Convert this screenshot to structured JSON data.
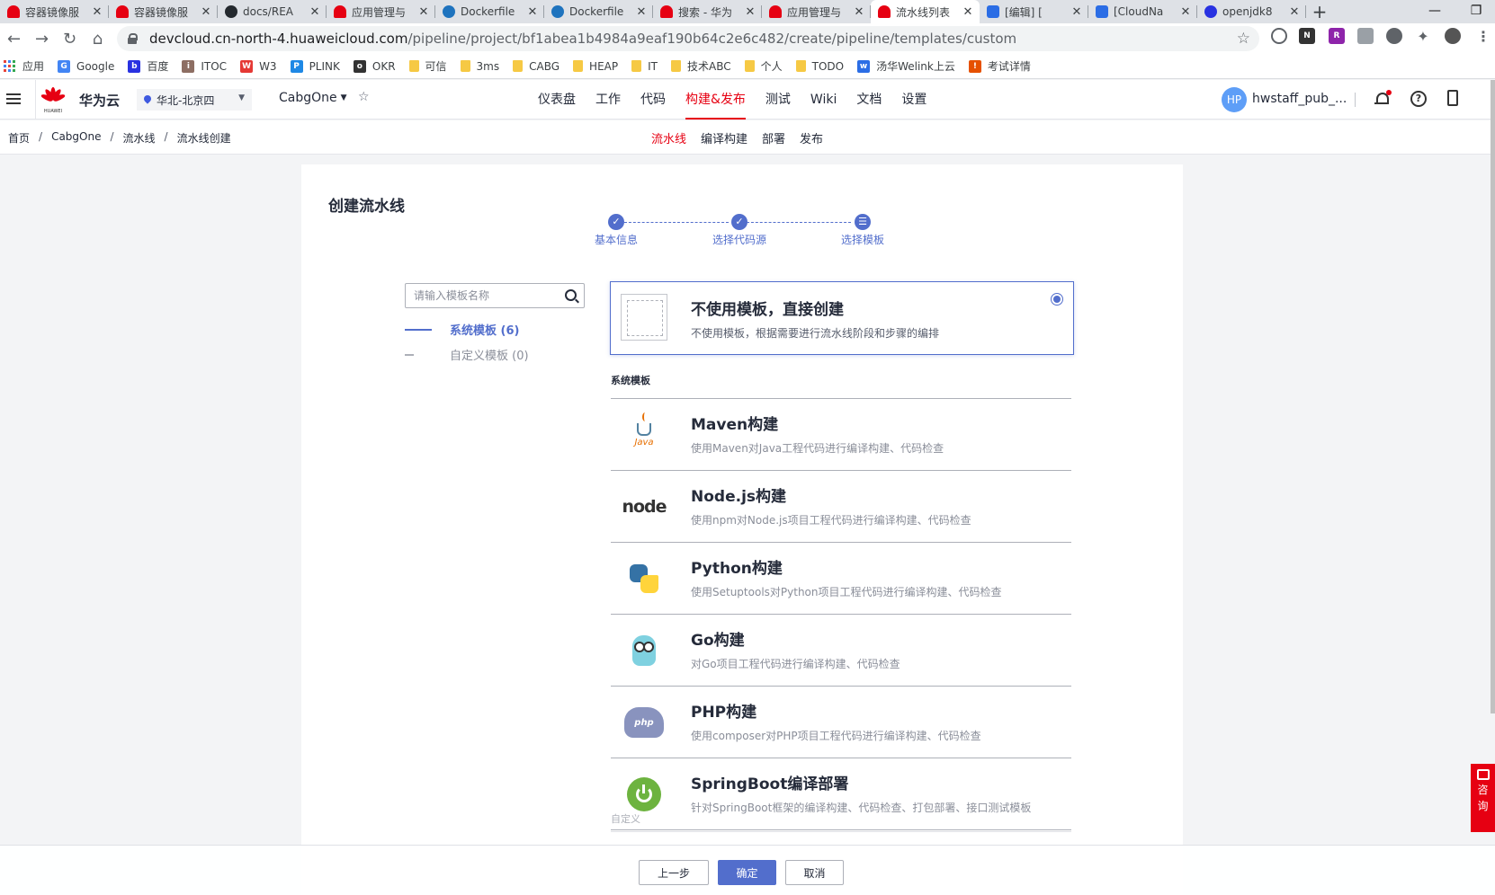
{
  "browser": {
    "tabs": [
      {
        "title": "容器镜像服",
        "favicon": "huawei-icon",
        "active": false
      },
      {
        "title": "容器镜像服",
        "favicon": "huawei-icon",
        "active": false
      },
      {
        "title": "docs/REA",
        "favicon": "github-icon",
        "active": false
      },
      {
        "title": "应用管理与",
        "favicon": "huawei-icon",
        "active": false
      },
      {
        "title": "Dockerfile",
        "favicon": "docker-icon",
        "active": false
      },
      {
        "title": "Dockerfile",
        "favicon": "docker-icon",
        "active": false
      },
      {
        "title": "搜索 - 华为",
        "favicon": "huawei-icon",
        "active": false
      },
      {
        "title": "应用管理与",
        "favicon": "huawei-icon",
        "active": false
      },
      {
        "title": "流水线列表",
        "favicon": "huawei-icon",
        "active": true
      },
      {
        "title": "[编辑] [",
        "favicon": "welink-icon",
        "active": false
      },
      {
        "title": "[CloudNa",
        "favicon": "welink-icon",
        "active": false
      },
      {
        "title": "openjdk8",
        "favicon": "baidu-icon",
        "active": false
      }
    ],
    "new_tab": "+",
    "window_controls": {
      "minimize": "—",
      "restore": "❐"
    },
    "url_host": "devcloud.cn-north-4.huaweicloud.com",
    "url_path": "/pipeline/project/bf1abea1b4984a9eaf190b64c2e6c482/create/pipeline/templates/custom",
    "bookmarks": [
      {
        "label": "应用",
        "icon": "apps-icon"
      },
      {
        "label": "Google",
        "icon": "google-icon"
      },
      {
        "label": "百度",
        "icon": "baidu-icon"
      },
      {
        "label": "ITOC",
        "icon": "itoc-icon"
      },
      {
        "label": "W3",
        "icon": "w3-icon"
      },
      {
        "label": "PLINK",
        "icon": "plink-icon"
      },
      {
        "label": "OKR",
        "icon": "okr-icon"
      },
      {
        "label": "可信",
        "icon": "folder-icon"
      },
      {
        "label": "3ms",
        "icon": "folder-icon"
      },
      {
        "label": "CABG",
        "icon": "folder-icon"
      },
      {
        "label": "HEAP",
        "icon": "folder-icon"
      },
      {
        "label": "IT",
        "icon": "folder-icon"
      },
      {
        "label": "技术ABC",
        "icon": "folder-icon"
      },
      {
        "label": "个人",
        "icon": "folder-icon"
      },
      {
        "label": "TODO",
        "icon": "folder-icon"
      },
      {
        "label": "汤华Welink上云",
        "icon": "welink-icon"
      },
      {
        "label": "考试详情",
        "icon": "exam-icon"
      }
    ]
  },
  "header": {
    "logo_text": "HUAWEI",
    "brand": "华为云",
    "region": "华北-北京四",
    "project": "CabgOne",
    "nav": [
      {
        "label": "仪表盘",
        "active": false
      },
      {
        "label": "工作",
        "active": false
      },
      {
        "label": "代码",
        "active": false
      },
      {
        "label": "构建&发布",
        "active": true
      },
      {
        "label": "测试",
        "active": false
      },
      {
        "label": "Wiki",
        "active": false
      },
      {
        "label": "文档",
        "active": false
      },
      {
        "label": "设置",
        "active": false
      }
    ],
    "avatar_initials": "HP",
    "username": "hwstaff_pub_..."
  },
  "breadcrumb": [
    "首页",
    "CabgOne",
    "流水线",
    "流水线创建"
  ],
  "breadcrumb_separator": "/",
  "subnav": [
    {
      "label": "流水线",
      "active": true
    },
    {
      "label": "编译构建",
      "active": false
    },
    {
      "label": "部署",
      "active": false
    },
    {
      "label": "发布",
      "active": false
    }
  ],
  "page": {
    "title": "创建流水线",
    "steps": [
      {
        "label": "基本信息",
        "state": "done",
        "icon": "check-icon"
      },
      {
        "label": "选择代码源",
        "state": "done",
        "icon": "check-icon"
      },
      {
        "label": "选择模板",
        "state": "current",
        "icon": "list-icon"
      }
    ],
    "step_glyphs": {
      "done": "✓",
      "current": "☰"
    },
    "search_placeholder": "请输入模板名称",
    "categories": [
      {
        "label": "系统模板 (6)",
        "active": true
      },
      {
        "label": "自定义模板 (0)",
        "active": false
      }
    ],
    "no_template": {
      "title": "不使用模板，直接创建",
      "desc": "不使用模板，根据需要进行流水线阶段和步骤的编排",
      "selected": true
    },
    "system_section_label": "系统模板",
    "templates": [
      {
        "title": "Maven构建",
        "desc": "使用Maven对Java工程代码进行编译构建、代码检查",
        "icon": "java-icon",
        "icon_text": "Java"
      },
      {
        "title": "Node.js构建",
        "desc": "使用npm对Node.js项目工程代码进行编译构建、代码检查",
        "icon": "nodejs-icon",
        "icon_text": "node"
      },
      {
        "title": "Python构建",
        "desc": "使用Setuptools对Python项目工程代码进行编译构建、代码检查",
        "icon": "python-icon",
        "icon_text": ""
      },
      {
        "title": "Go构建",
        "desc": "对Go项目工程代码进行编译构建、代码检查",
        "icon": "go-icon",
        "icon_text": ""
      },
      {
        "title": "PHP构建",
        "desc": "使用composer对PHP项目工程代码进行编译构建、代码检查",
        "icon": "php-icon",
        "icon_text": "php"
      },
      {
        "title": "SpringBoot编译部署",
        "desc": "针对SpringBoot框架的编译构建、代码检查、打包部署、接口测试模板",
        "icon": "springboot-icon",
        "icon_text": ""
      }
    ],
    "custom_section_peek": "自定义"
  },
  "footer": {
    "prev": "上一步",
    "confirm": "确定",
    "cancel": "取消"
  },
  "consult": {
    "chars": [
      "咨",
      "询"
    ]
  },
  "colors": {
    "brand_red": "#e60012",
    "primary_blue": "#526ecc",
    "text_primary": "#252b3a",
    "text_secondary": "#8a8e99"
  }
}
